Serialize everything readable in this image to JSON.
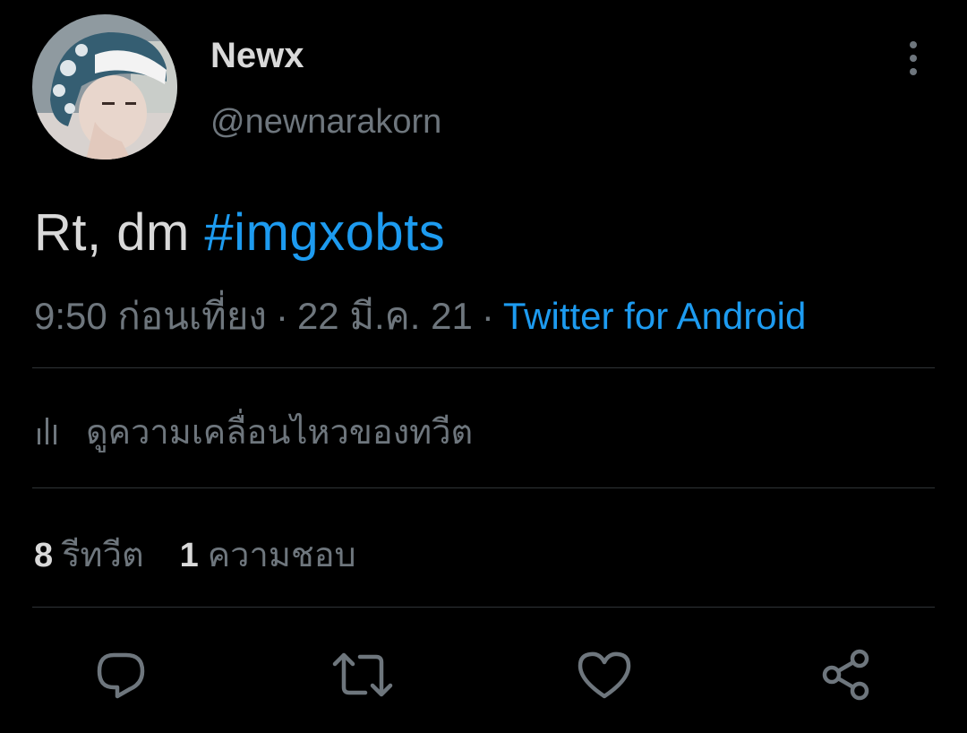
{
  "author": {
    "display_name": "Newx",
    "handle": "@newnarakorn",
    "avatar_icon": "profile-photo"
  },
  "menu": {
    "icon": "more-vertical-icon"
  },
  "tweet": {
    "text_prefix": "Rt, dm ",
    "hashtag": "#imgxobts"
  },
  "meta": {
    "time": "9:50 ก่อนเที่ยง",
    "separator": "·",
    "date": "22 มี.ค. 21",
    "source": "Twitter for Android"
  },
  "activity": {
    "icon": "analytics-bars-icon",
    "label": "ดูความเคลื่อนไหวของทวีต"
  },
  "stats": {
    "retweets_count": "8",
    "retweets_label": "รีทวีต",
    "likes_count": "1",
    "likes_label": "ความชอบ"
  },
  "actions": [
    {
      "name": "reply",
      "icon": "reply-icon"
    },
    {
      "name": "retweet",
      "icon": "retweet-icon"
    },
    {
      "name": "like",
      "icon": "heart-icon"
    },
    {
      "name": "share",
      "icon": "share-icon"
    }
  ],
  "colors": {
    "background": "#000000",
    "text_primary": "#d9d9d9",
    "text_secondary": "#6e767d",
    "accent": "#1d9bf0",
    "divider": "#2f3336"
  }
}
